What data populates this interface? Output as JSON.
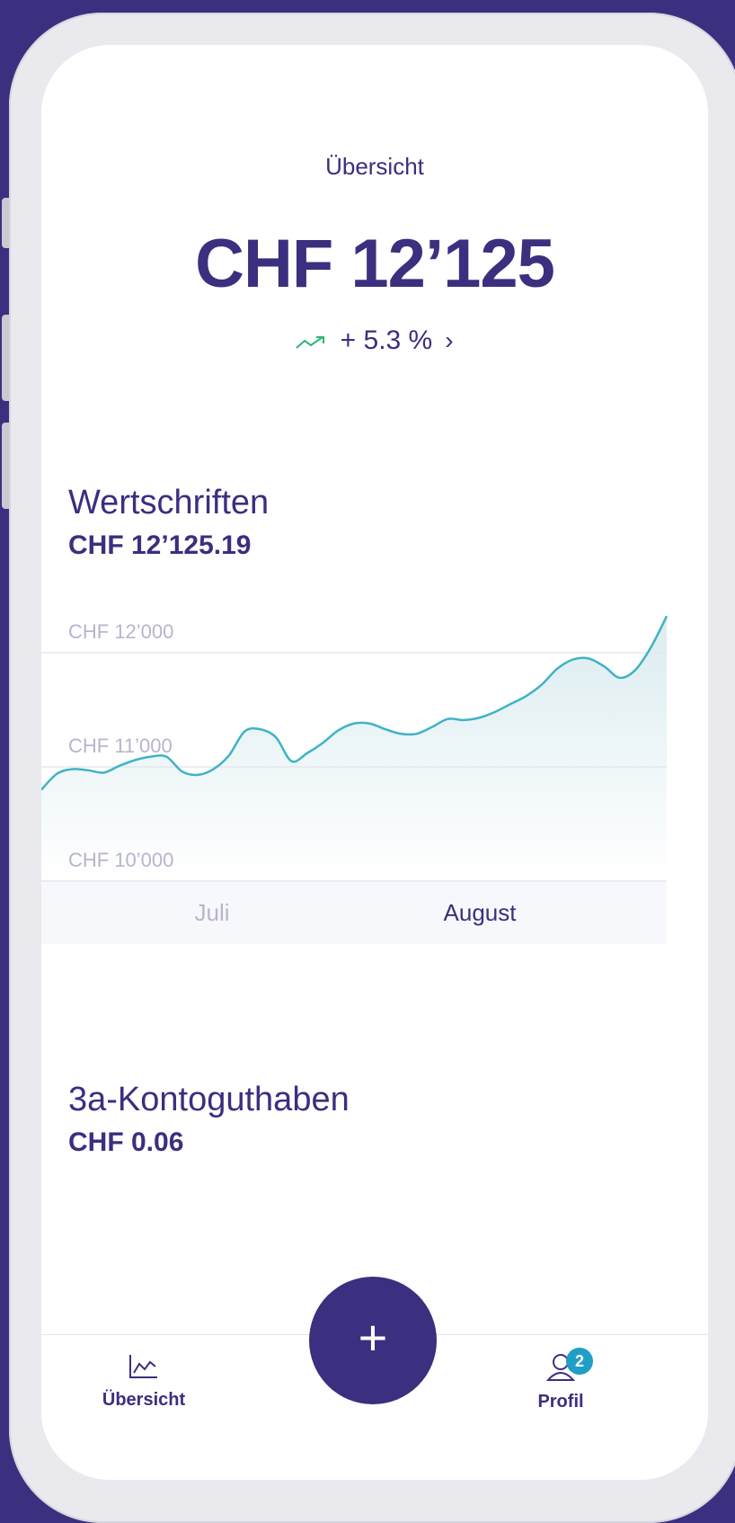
{
  "header": {
    "title": "Übersicht"
  },
  "portfolio": {
    "total": "CHF 12’125",
    "change": "+ 5.3 %"
  },
  "securities": {
    "title": "Wertschriften",
    "value": "CHF 12’125.19"
  },
  "chart_data": {
    "type": "area",
    "x_labels": [
      "Juli",
      "August"
    ],
    "y_ticks": [
      "CHF 12’000",
      "CHF 11’000",
      "CHF 10’000"
    ],
    "ylim": [
      10000,
      12500
    ],
    "values": [
      10800,
      10940,
      10980,
      10970,
      10950,
      11010,
      11060,
      11090,
      11090,
      10960,
      10930,
      10980,
      11100,
      11310,
      11330,
      11260,
      11050,
      11120,
      11210,
      11320,
      11380,
      11380,
      11330,
      11290,
      11290,
      11350,
      11420,
      11410,
      11430,
      11480,
      11550,
      11620,
      11720,
      11860,
      11940,
      11950,
      11880,
      11780,
      11850,
      12050,
      12320
    ],
    "line_color": "#3fb3c5",
    "fill_color": "#dfeef1",
    "grid": true
  },
  "pillar3a": {
    "title": "3a-Kontoguthaben",
    "value": "CHF 0.06"
  },
  "tabbar": {
    "overview_label": "Übersicht",
    "profile_label": "Profil",
    "profile_badge": "2",
    "add_symbol": "+"
  },
  "colors": {
    "brand": "#3b2f7f",
    "positive": "#2bb673",
    "badge": "#1e9fc6"
  }
}
